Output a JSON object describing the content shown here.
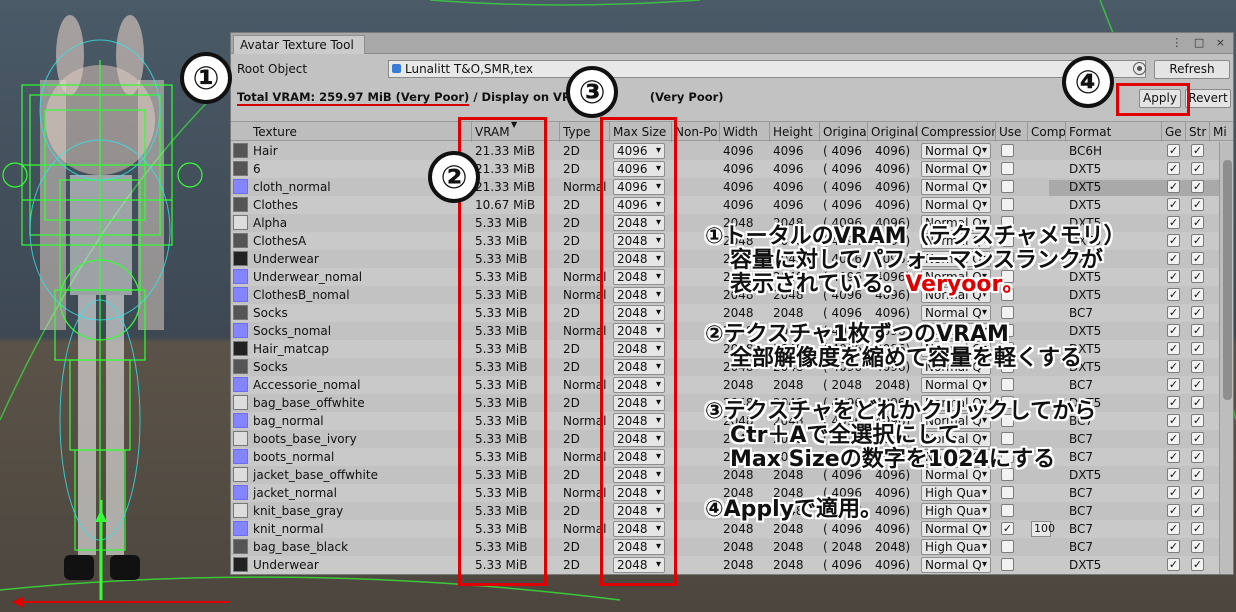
{
  "window": {
    "tab_title": "Avatar Texture Tool",
    "menu_icon": "⋮",
    "maximize_icon": "□",
    "close_icon": "×"
  },
  "root_object": {
    "label": "Root Object",
    "value": "Lunalitt T&O,SMR,tex",
    "refresh_label": "Refresh"
  },
  "vram": {
    "total": "Total VRAM: 259.97 MiB (Very Poor)",
    "display_prefix": "/ Display on VRC: 2",
    "display_suffix": "(Very Poor)",
    "apply_label": "Apply",
    "revert_label": "Revert"
  },
  "columns": [
    "Texture",
    "VRAM",
    "Type",
    "Max Size",
    "Non-Po",
    "Width",
    "Height",
    "Original",
    "Original",
    "Compression",
    "Use",
    "Comp",
    "Format",
    "Ge",
    "Str",
    "Mi"
  ],
  "rows": [
    {
      "name": "Hair",
      "thumb": "photo",
      "vram": "21.33 MiB",
      "type": "2D",
      "max": "4096",
      "width": "4096",
      "height": "4096",
      "ow": "( 4096",
      "oh": "4096)",
      "comp": "Normal Q",
      "use": false,
      "cq": "",
      "format": "BC6H"
    },
    {
      "name": "6",
      "thumb": "photo",
      "vram": "21.33 MiB",
      "type": "2D",
      "max": "4096",
      "width": "4096",
      "height": "4096",
      "ow": "( 4096",
      "oh": "4096)",
      "comp": "Normal Q",
      "use": false,
      "cq": "",
      "format": "DXT5"
    },
    {
      "name": "cloth_normal",
      "thumb": "normal",
      "vram": "21.33 MiB",
      "type": "Normal",
      "max": "4096",
      "width": "4096",
      "height": "4096",
      "ow": "( 4096",
      "oh": "4096)",
      "comp": "Normal Q",
      "use": false,
      "cq": "",
      "format": "DXT5"
    },
    {
      "name": "Clothes",
      "thumb": "photo",
      "vram": "10.67 MiB",
      "type": "2D",
      "max": "4096",
      "width": "4096",
      "height": "4096",
      "ow": "( 4096",
      "oh": "4096)",
      "comp": "Normal Q",
      "use": false,
      "cq": "",
      "format": "DXT5"
    },
    {
      "name": "Alpha",
      "thumb": "light",
      "vram": "5.33 MiB",
      "type": "2D",
      "max": "2048",
      "width": "2048",
      "height": "2048",
      "ow": "( 4096",
      "oh": "4096)",
      "comp": "Normal Q",
      "use": false,
      "cq": "",
      "format": "DXT5"
    },
    {
      "name": "ClothesA",
      "thumb": "photo",
      "vram": "5.33 MiB",
      "type": "2D",
      "max": "2048",
      "width": "2048",
      "height": "2048",
      "ow": "( 4096",
      "oh": "4096)",
      "comp": "Normal Q",
      "use": false,
      "cq": "",
      "format": "DXT5"
    },
    {
      "name": "Underwear",
      "thumb": "dark",
      "vram": "5.33 MiB",
      "type": "2D",
      "max": "2048",
      "width": "2048",
      "height": "2048",
      "ow": "( 4096",
      "oh": "4096)",
      "comp": "Normal Q",
      "use": false,
      "cq": "",
      "format": "DXT5"
    },
    {
      "name": "Underwear_nomal",
      "thumb": "normal",
      "vram": "5.33 MiB",
      "type": "Normal",
      "max": "2048",
      "width": "2048",
      "height": "2048",
      "ow": "( 4096",
      "oh": "4096)",
      "comp": "Normal Q",
      "use": false,
      "cq": "",
      "format": "DXT5"
    },
    {
      "name": "ClothesB_nomal",
      "thumb": "normal",
      "vram": "5.33 MiB",
      "type": "Normal",
      "max": "2048",
      "width": "2048",
      "height": "2048",
      "ow": "( 4096",
      "oh": "4096)",
      "comp": "Normal Q",
      "use": false,
      "cq": "",
      "format": "DXT5"
    },
    {
      "name": "Socks",
      "thumb": "photo",
      "vram": "5.33 MiB",
      "type": "2D",
      "max": "2048",
      "width": "2048",
      "height": "2048",
      "ow": "( 4096",
      "oh": "4096)",
      "comp": "Normal Q",
      "use": false,
      "cq": "",
      "format": "BC7"
    },
    {
      "name": "Socks_nomal",
      "thumb": "normal",
      "vram": "5.33 MiB",
      "type": "Normal",
      "max": "2048",
      "width": "2048",
      "height": "2048",
      "ow": "( 4096",
      "oh": "4096)",
      "comp": "Normal Q",
      "use": false,
      "cq": "",
      "format": "DXT5"
    },
    {
      "name": "Hair_matcap",
      "thumb": "dark",
      "vram": "5.33 MiB",
      "type": "2D",
      "max": "2048",
      "width": "2048",
      "height": "2048",
      "ow": "( 4096",
      "oh": "4096)",
      "comp": "Normal Q",
      "use": false,
      "cq": "",
      "format": "DXT5"
    },
    {
      "name": "Socks",
      "thumb": "photo",
      "vram": "5.33 MiB",
      "type": "2D",
      "max": "2048",
      "width": "2048",
      "height": "2048",
      "ow": "( 4096",
      "oh": "4096)",
      "comp": "Normal Q",
      "use": false,
      "cq": "",
      "format": "DXT5"
    },
    {
      "name": "Accessorie_nomal",
      "thumb": "normal",
      "vram": "5.33 MiB",
      "type": "Normal",
      "max": "2048",
      "width": "2048",
      "height": "2048",
      "ow": "( 2048",
      "oh": "2048)",
      "comp": "Normal Q",
      "use": false,
      "cq": "",
      "format": "BC7"
    },
    {
      "name": "bag_base_offwhite",
      "thumb": "light",
      "vram": "5.33 MiB",
      "type": "2D",
      "max": "2048",
      "width": "2048",
      "height": "2048",
      "ow": "( 4096",
      "oh": "4096)",
      "comp": "Normal Q",
      "use": false,
      "cq": "",
      "format": "DXT5"
    },
    {
      "name": "bag_normal",
      "thumb": "normal",
      "vram": "5.33 MiB",
      "type": "Normal",
      "max": "2048",
      "width": "2048",
      "height": "2048",
      "ow": "( 4096",
      "oh": "4096)",
      "comp": "Normal Q",
      "use": false,
      "cq": "",
      "format": "BC7"
    },
    {
      "name": "boots_base_ivory",
      "thumb": "light",
      "vram": "5.33 MiB",
      "type": "2D",
      "max": "2048",
      "width": "2048",
      "height": "2048",
      "ow": "( 4096",
      "oh": "4096)",
      "comp": "Normal Q",
      "use": false,
      "cq": "",
      "format": "BC7"
    },
    {
      "name": "boots_normal",
      "thumb": "normal",
      "vram": "5.33 MiB",
      "type": "Normal",
      "max": "2048",
      "width": "2048",
      "height": "2048",
      "ow": "( 4096",
      "oh": "4096)",
      "comp": "Normal Q",
      "use": false,
      "cq": "",
      "format": "BC7"
    },
    {
      "name": "jacket_base_offwhite",
      "thumb": "light",
      "vram": "5.33 MiB",
      "type": "2D",
      "max": "2048",
      "width": "2048",
      "height": "2048",
      "ow": "( 4096",
      "oh": "4096)",
      "comp": "Normal Q",
      "use": false,
      "cq": "",
      "format": "DXT5"
    },
    {
      "name": "jacket_normal",
      "thumb": "normal",
      "vram": "5.33 MiB",
      "type": "Normal",
      "max": "2048",
      "width": "2048",
      "height": "2048",
      "ow": "( 4096",
      "oh": "4096)",
      "comp": "High Qua",
      "use": false,
      "cq": "",
      "format": "BC7"
    },
    {
      "name": "knit_base_gray",
      "thumb": "light",
      "vram": "5.33 MiB",
      "type": "2D",
      "max": "2048",
      "width": "2048",
      "height": "2048",
      "ow": "( 4096",
      "oh": "4096)",
      "comp": "High Qua",
      "use": false,
      "cq": "",
      "format": "BC7"
    },
    {
      "name": "knit_normal",
      "thumb": "normal",
      "vram": "5.33 MiB",
      "type": "Normal",
      "max": "2048",
      "width": "2048",
      "height": "2048",
      "ow": "( 4096",
      "oh": "4096)",
      "comp": "Normal Q",
      "use": true,
      "cq": "100",
      "format": "BC7"
    },
    {
      "name": "bag_base_black",
      "thumb": "photo",
      "vram": "5.33 MiB",
      "type": "2D",
      "max": "2048",
      "width": "2048",
      "height": "2048",
      "ow": "( 2048",
      "oh": "2048)",
      "comp": "High Qua",
      "use": false,
      "cq": "",
      "format": "BC7"
    },
    {
      "name": "Underwear",
      "thumb": "dark",
      "vram": "5.33 MiB",
      "type": "2D",
      "max": "2048",
      "width": "2048",
      "height": "2048",
      "ow": "( 4096",
      "oh": "4096)",
      "comp": "Normal Q",
      "use": false,
      "cq": "",
      "format": "DXT5"
    }
  ],
  "check_mark": "✓",
  "annotations": {
    "badge1": "①",
    "badge2": "②",
    "badge3": "③",
    "badge4": "④",
    "note1_line1": "①トータルのVRAM（テクスチャメモリ）",
    "note1_line2": "容量に対してパフォーマンスランクが",
    "note1_line3": "表示されている。",
    "note1_red": "Veryoor。",
    "note2_line1": "②テクスチャ1枚ずつのVRAM",
    "note2_line2": "全部解像度を縮めて容量を軽くする",
    "note3_line1": "③テクスチャをどれかクリックしてから",
    "note3_line2": "Ctr＋Aで全選択にして",
    "note3_line3": "Max Sizeの数字を1024にする",
    "note4_line1": "④Applyで適用。"
  },
  "colors": {
    "annotation_red": "#e00000",
    "normal_map_thumb": "#8484ff",
    "wireframe_green": "#33ff33",
    "wireframe_cyan": "#33e6e6"
  }
}
